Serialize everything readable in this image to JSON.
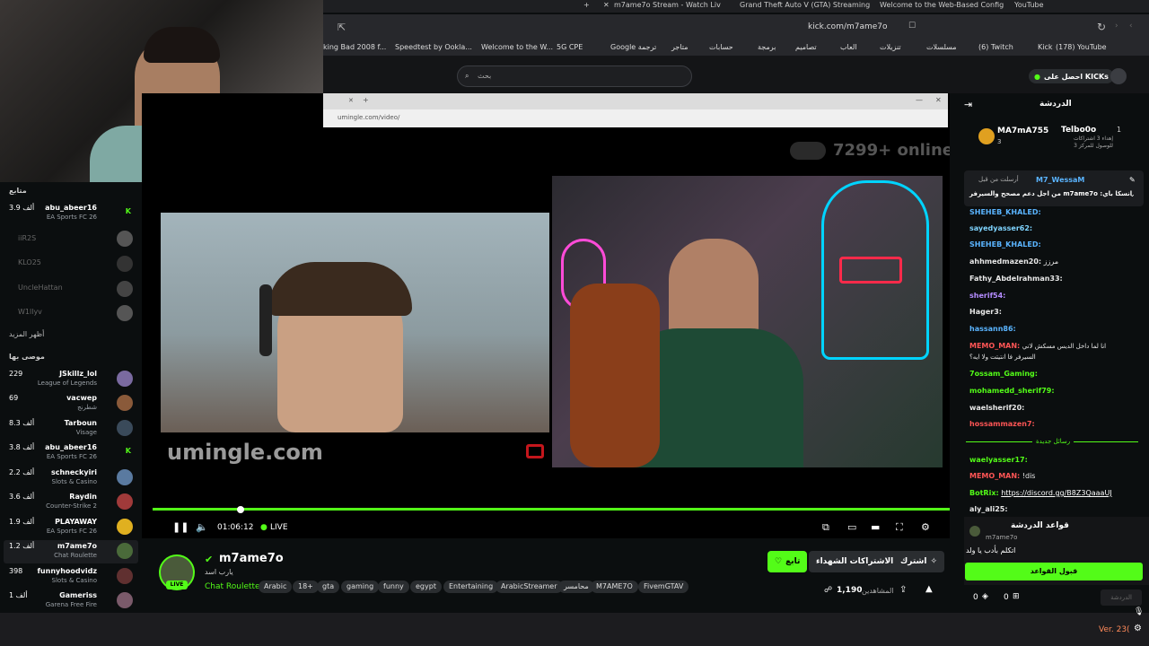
{
  "browser": {
    "tabs": [
      "m7ame7o Stream - Watch Liv",
      "Grand Theft Auto V (GTA) Streaming",
      "Welcome to the Web-Based Config",
      "YouTube"
    ],
    "url": "kick.com/m7ame7o",
    "bookmarks": [
      "king Bad 2008 f...",
      "Speedtest by Ookla...",
      "Welcome to the W...",
      "5G CPE",
      "Google ترجمة",
      "متاجر",
      "حسابات",
      "برمجة",
      "تصاميم",
      "العاب",
      "تنزيلات",
      "مسلسلات",
      "(6) Twitch",
      "Kick",
      "(178) YouTube"
    ]
  },
  "header": {
    "search_placeholder": "بحث",
    "kicks_button": "احصل على KICKs"
  },
  "sidebar": {
    "following_heading": "متابع",
    "following": [
      {
        "count": "3.9 ألف",
        "name": "abu_abeer16",
        "category": "EA Sports FC 26"
      }
    ],
    "offline": [
      "iiR2S",
      "KLO25",
      "UncleHattan",
      "W1llyv"
    ],
    "show_more": "أظهر المزيد",
    "recommended_heading": "موصى بها",
    "recommended": [
      {
        "count": "229",
        "name": "JSkillz_lol",
        "category": "League of Legends"
      },
      {
        "count": "69",
        "name": "vacwep",
        "category": "شطرنج"
      },
      {
        "count": "8.3 ألف",
        "name": "Tarboun",
        "category": "Visage"
      },
      {
        "count": "3.8 ألف",
        "name": "abu_abeer16",
        "category": "EA Sports FC 26"
      },
      {
        "count": "2.2 ألف",
        "name": "schneckyiri",
        "category": "Slots & Casino"
      },
      {
        "count": "3.6 ألف",
        "name": "Raydin",
        "category": "Counter-Strike 2"
      },
      {
        "count": "1.9 ألف",
        "name": "PLAYAWAY",
        "category": "EA Sports FC 26"
      },
      {
        "count": "1.2 ألف",
        "name": "m7ame7o",
        "category": "Chat Roulette"
      },
      {
        "count": "398",
        "name": "funnyhoodvidz",
        "category": "Slots & Casino"
      },
      {
        "count": "1 ألف",
        "name": "Gameriss",
        "category": "Garena Free Fire"
      }
    ]
  },
  "player": {
    "inner_url": "umingle.com/video/",
    "online_text": "7299+ online",
    "umingle_logo": "umingle.com",
    "time": "01:06:12",
    "live": "LIVE"
  },
  "stream_info": {
    "channel": "m7ame7o",
    "subtitle": "يارب اسد",
    "category": "Chat Roulette",
    "tags": [
      "Arabic",
      "18+",
      "gta",
      "gaming",
      "funny",
      "egypt",
      "Entertaining",
      "ArabicStreamer",
      "محامسر",
      "M7AME7O",
      "FivemGTAV"
    ],
    "follow_button": "تابع",
    "gift_button": "الاشتراكات الشهداء",
    "subscribe_button": "اشترك",
    "viewers": "1,190",
    "viewers_label": "المشاهدين",
    "live_badge": "LIVE"
  },
  "chat": {
    "title": "الدردشة",
    "leaderboard": [
      {
        "name": "MA7mA755",
        "count": "3"
      },
      {
        "name": "Telbo0o",
        "count": "1",
        "note": "إهداء 3 اشتراكات للوصول للمركز 3"
      }
    ],
    "pinned_user": "M7_WessaM",
    "pinned_label": "أرسلت من قبل",
    "pinned_text": "من اجل دعم مصحح والسيرفر m7ame7o :انسكا باي",
    "messages": [
      {
        "user": "SHEHEB_KHALED:",
        "text": "",
        "color": "#5ab4ff"
      },
      {
        "user": "sayedyasser62:",
        "text": "",
        "color": "#7fd4ff"
      },
      {
        "user": "SHEHEB_KHALED:",
        "text": "",
        "color": "#5ab4ff"
      },
      {
        "user": "ahhmedmazen20:",
        "text": "مرزز",
        "color": "#e8e8e8"
      },
      {
        "user": "Fathy_Abdelrahman33:",
        "text": "",
        "color": "#e8e8e8"
      },
      {
        "user": "sherif54:",
        "text": "",
        "color": "#b48cff"
      },
      {
        "user": "Hager3:",
        "text": "",
        "color": "#e8e8e8"
      },
      {
        "user": "hassann86:",
        "text": "",
        "color": "#5ab4ff"
      },
      {
        "user": "MEMO_MAN:",
        "text": "انا لما داخل الديس مسكش لاني السيرفر فا انتيتت ولا ايه؟",
        "color": "#ff5555"
      },
      {
        "user": "7ossam_Gaming:",
        "text": "",
        "color": "#53fc18"
      },
      {
        "user": "mohamedd_sherif79:",
        "text": "",
        "color": "#53fc18"
      },
      {
        "user": "waelsherif20:",
        "text": "",
        "color": "#e8e8e8"
      },
      {
        "user": "hossammazen7:",
        "text": "",
        "color": "#ff5555"
      },
      {
        "user": "waelyasser17:",
        "text": "",
        "color": "#53fc18"
      },
      {
        "user": "MEMO_MAN:",
        "text": "!dis",
        "color": "#ff5555"
      },
      {
        "user": "BotRix:",
        "text": "https://discord.gg/B8Z3QaaaUJ",
        "color": "#53fc18"
      },
      {
        "user": "aly_ali25:",
        "text": "",
        "color": "#e8e8e8"
      }
    ],
    "new_messages": "رسائل جديدة",
    "rules_title": "قواعد الدردشة",
    "rules_user": "m7ame7o",
    "rules_text": "اتكلم بأدب يا ولد",
    "accept_rules": "قبول القواعد",
    "chat_input_label": "الدردشة",
    "counter_a": "0",
    "counter_b": "0"
  },
  "bottom": {
    "version": "Ver. 23("
  },
  "colors": {
    "accent": "#53fc18",
    "background": "#0b0e0f"
  }
}
